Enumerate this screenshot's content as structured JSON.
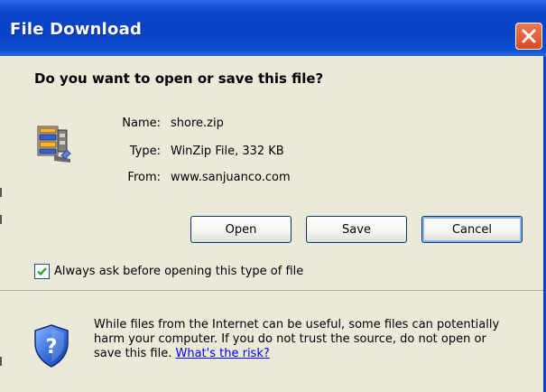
{
  "window": {
    "title": "File Download",
    "close_icon": "close-icon"
  },
  "dialog": {
    "question": "Do you want to open or save this file?",
    "file_icon": "zip-archive-icon",
    "fields": {
      "name_label": "Name:",
      "name_value": "shore.zip",
      "type_label": "Type:",
      "type_value": "WinZip File, 332 KB",
      "from_label": "From:",
      "from_value": "www.sanjuanco.com"
    },
    "buttons": {
      "open": "Open",
      "save": "Save",
      "cancel": "Cancel"
    },
    "checkbox": {
      "label": "Always ask before opening this type of file",
      "checked": true
    },
    "warning": {
      "icon": "security-shield-icon",
      "line1": "While files from the Internet can be useful, some files can potentially",
      "line2": "harm your computer. If you do not trust the source, do not open or",
      "line3_prefix": "save this file.",
      "link": "What's the risk?"
    }
  },
  "colors": {
    "title_bar": "#0a46c9",
    "dialog_bg": "#ece9d8",
    "close_button": "#d84a26",
    "link": "#0000ff"
  }
}
